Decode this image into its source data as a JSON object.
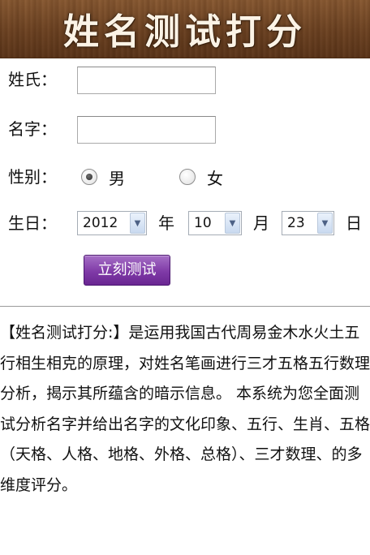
{
  "banner": {
    "title": "姓名测试打分"
  },
  "form": {
    "surname_label": "姓氏：",
    "surname_value": "",
    "given_name_label": "名字：",
    "given_name_value": "",
    "gender_label": "性别：",
    "gender_options": [
      {
        "label": "男",
        "checked": true
      },
      {
        "label": "女",
        "checked": false
      }
    ],
    "birthday_label": "生日：",
    "year_value": "2012",
    "year_unit": "年",
    "month_value": "10",
    "month_unit": "月",
    "day_value": "23",
    "day_unit": "日",
    "submit_label": "立刻测试"
  },
  "description": {
    "text": "【姓名测试打分:】是运用我国古代周易金木水火土五行相生相克的原理，对姓名笔画进行三才五格五行数理分析，揭示其所蕴含的暗示信息。 本系统为您全面测试分析名字并给出名字的文化印象、五行、生肖、五格（天格、人格、地格、外格、总格）、三才数理、的多维度评分。"
  }
}
